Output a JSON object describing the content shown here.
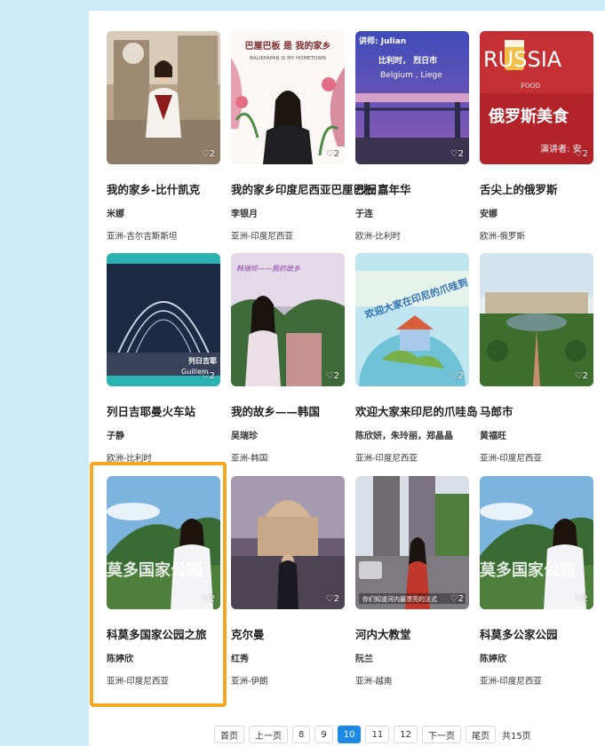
{
  "cards": [
    {
      "title": "我的家乡-比什凯克",
      "author": "米娜",
      "region": "亚洲-吉尔吉斯斯坦",
      "likes": "2",
      "overlay": ""
    },
    {
      "title": "我的家乡印度尼西亚巴厘巴板",
      "author": "李银月",
      "region": "亚洲-印度尼西亚",
      "likes": "2",
      "overlay": "巴厘巴板 是 我的家乡",
      "overlay2": "BALIKPAPAN IS MY HOMETOWN"
    },
    {
      "title": "烈日嘉年华",
      "author": "于连",
      "region": "欧洲-比利时",
      "likes": "2",
      "overlay": "讲师: Julian",
      "overlay2": "比利时， 烈日市",
      "overlay3": "Belgium , Liege"
    },
    {
      "title": "舌尖上的俄罗斯",
      "author": "安娜",
      "region": "欧洲-俄罗斯",
      "likes": "2",
      "overlay": "RUSSIA",
      "overlay2": "FOOD",
      "overlay3": "俄罗斯美食",
      "overlay4": "演讲者: 安"
    },
    {
      "title": "列日吉耶曼火车站",
      "author": "子静",
      "region": "欧洲-比利时",
      "likes": "2",
      "overlay": "列日吉耶",
      "overlay2": "Guillem"
    },
    {
      "title": "我的故乡——韩国",
      "author": "吴瑞珍",
      "region": "亚洲-韩国",
      "likes": "2",
      "overlay": "韩瑞珍——我的故乡"
    },
    {
      "title": "欢迎大家来印尼的爪哇岛",
      "author": "陈欣妍，朱玲丽，郑晶晶",
      "region": "亚洲-印度尼西亚",
      "likes": "2",
      "overlay": "欢迎大家在印尼的爪哇到"
    },
    {
      "title": "马郎市",
      "author": "黄福旺",
      "region": "亚洲-印度尼西亚",
      "likes": "2",
      "overlay": ""
    },
    {
      "title": "科莫多国家公园之旅",
      "author": "陈婷欣",
      "region": "亚洲-印度尼西亚",
      "likes": "2",
      "overlay": "莫多国家公园"
    },
    {
      "title": "克尔曼",
      "author": "红秀",
      "region": "亚洲-伊朗",
      "likes": "2",
      "overlay": ""
    },
    {
      "title": "河内大教堂",
      "author": "阮兰",
      "region": "亚洲-越南",
      "likes": "2",
      "overlay": "你们知道河内最漂亮的法式"
    },
    {
      "title": "科莫多公家公园",
      "author": "陈婷欣",
      "region": "亚洲-印度尼西亚",
      "likes": "2",
      "overlay": "莫多国家公园"
    }
  ],
  "pagination": {
    "first": "首页",
    "prev": "上一页",
    "pages": [
      "8",
      "9",
      "10",
      "11",
      "12"
    ],
    "current": "10",
    "next": "下一页",
    "last": "尾页",
    "total": "共15页"
  },
  "colors": {
    "accent": "#1e88e5",
    "highlight": "#f5a623",
    "background": "#cdeaf6"
  }
}
